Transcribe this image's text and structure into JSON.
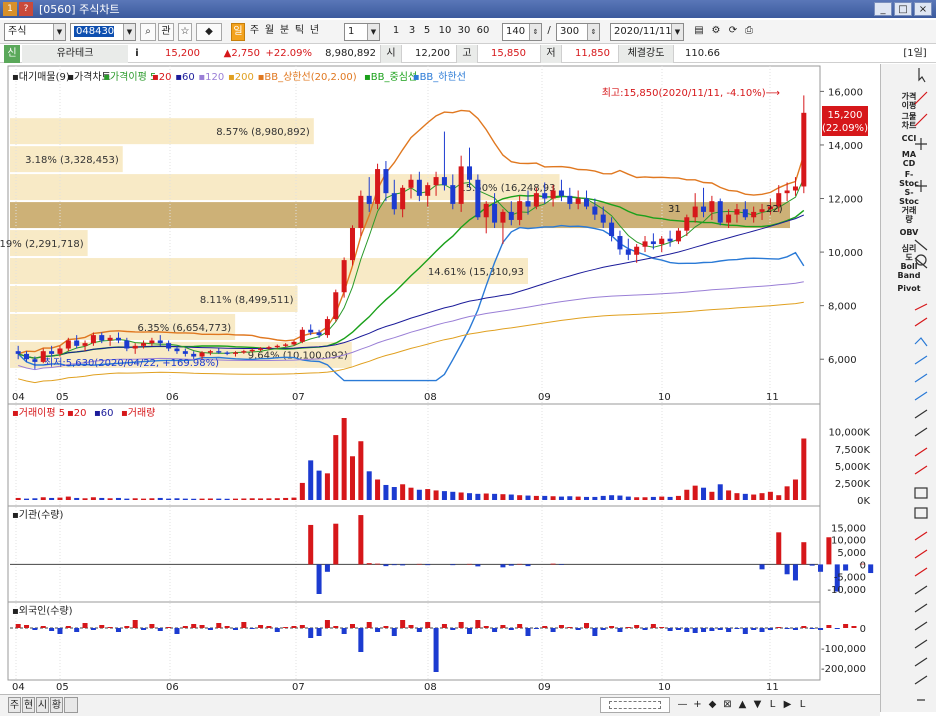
{
  "window": {
    "screen_code": "[0560]",
    "title": "주식차트",
    "buttons": [
      "_",
      "□",
      "×"
    ]
  },
  "toolbar": {
    "market": "주식",
    "code": "048430",
    "lookup_label": "관",
    "periods": [
      "일",
      "주",
      "월",
      "분",
      "틱",
      "년"
    ],
    "active_period": "일",
    "unit_value": "1",
    "minute_options": [
      "1",
      "3",
      "5",
      "10",
      "30",
      "60"
    ],
    "count_value": "140",
    "range_sep": "/",
    "total_value": "300",
    "date_value": "2020/11/11"
  },
  "info": {
    "badge": "신",
    "stock_name": "유라테크",
    "info_icon": "i",
    "price": "15,200",
    "change": "▲2,750",
    "change_pct": "+22.09%",
    "volume": "8,980,892",
    "open_label": "시",
    "open": "12,200",
    "high_label": "고",
    "high": "15,850",
    "low_label": "저",
    "low": "11,850",
    "strength_label": "체결강도",
    "strength": "110.66",
    "period_badge": "[1일]"
  },
  "legend": {
    "price": [
      {
        "text": "▪대기매물(9)",
        "color": "#222222"
      },
      {
        "text": "▪가격차트",
        "color": "#222222"
      },
      {
        "text": "▪가격이평 5",
        "color": "#2a9a2a"
      },
      {
        "text": "▪20",
        "color": "#d6171a"
      },
      {
        "text": "▪60",
        "color": "#1c1c9a"
      },
      {
        "text": "▪120",
        "color": "#9a7fd6"
      },
      {
        "text": "▪200",
        "color": "#e0a020"
      },
      {
        "text": "▪BB_상한선(20,2.00)",
        "color": "#e07820"
      },
      {
        "text": "▪BB_중심선",
        "color": "#1aa01a"
      },
      {
        "text": "▪BB_하한선",
        "color": "#2a7ad6"
      }
    ],
    "volume": [
      {
        "text": "▪거래이평 5",
        "color": "#d6171a"
      },
      {
        "text": "▪20",
        "color": "#d6171a"
      },
      {
        "text": "▪60",
        "color": "#1c1c9a"
      },
      {
        "text": "▪거래량",
        "color": "#d6171a"
      }
    ],
    "inst": "▪기관(수량)",
    "foreign": "▪외국인(수량)"
  },
  "annotations": {
    "high": "최고:15,850(2020/11/11, -4.10%)⟶",
    "low": "최저:5,630(2020/04/22, +169.98%)",
    "price_tag_1": "15,200",
    "price_tag_2": "(22.09%)"
  },
  "volume_profile": [
    {
      "label": "8.57% (8,980,892)",
      "pct": 8.57
    },
    {
      "label": "3.18% (3,328,453)",
      "pct": 3.18
    },
    {
      "label": "15.50% (16,248,93",
      "pct": 15.5
    },
    {
      "label": "",
      "pct": 22
    },
    {
      "label": "2.19% (2,291,718)",
      "pct": 2.19
    },
    {
      "label": "14.61% (15,310,93",
      "pct": 14.61
    },
    {
      "label": "8.11% (8,499,511)",
      "pct": 8.11
    },
    {
      "label": "6.35% (6,654,773)",
      "pct": 6.35
    },
    {
      "label": "9.64% (10,100,092)",
      "pct": 9.64
    }
  ],
  "overlap_label": "31",
  "overlap_label2": "22)",
  "axes": {
    "months": [
      "04",
      "05",
      "06",
      "07",
      "08",
      "09",
      "10",
      "11"
    ],
    "price_ticks": [
      "16,000",
      "14,000",
      "12,000",
      "10,000",
      "8,000",
      "6,000"
    ],
    "volume_ticks": [
      "10,000K",
      "7,500K",
      "5,000K",
      "2,500K",
      "0K"
    ],
    "inst_ticks": [
      "15,000",
      "10,000",
      "5,000",
      "0",
      "-5,000",
      "-10,000"
    ],
    "foreign_ticks": [
      "0",
      "-100,000",
      "-200,000"
    ]
  },
  "sidebar": {
    "text_items": [
      "가격\n이평",
      "그물\n차트",
      "CCI",
      "MA\nCD",
      "F-\nStoc",
      "S-\nStoc",
      "거래\n량",
      "OBV",
      "심리\n도",
      "Boll\nBand",
      "Pivot"
    ],
    "icons": [
      "cursor-icon",
      "crosshair-icon",
      "magnify-icon",
      "text-icon",
      "line-icon",
      "circle-icon",
      "fibonacci-icon",
      "trendline-icon",
      "ruler-icon",
      "print-icon"
    ]
  },
  "bottom": {
    "tabs": [
      "주",
      "현",
      "시",
      "황"
    ],
    "nav": [
      "—",
      "+",
      "◆",
      "⊠",
      "▲",
      "▼",
      "L",
      "▶",
      "L"
    ]
  },
  "chart_data": [
    {
      "type": "candlestick",
      "title": "",
      "x": [
        "04",
        "05",
        "06",
        "07",
        "08",
        "09",
        "10",
        "11"
      ],
      "ylim": [
        5000,
        16500
      ],
      "candles": [
        [
          6300,
          6500,
          6000,
          6200
        ],
        [
          6200,
          6300,
          5900,
          6000
        ],
        [
          6000,
          6100,
          5630,
          5900
        ],
        [
          5900,
          6400,
          5850,
          6300
        ],
        [
          6300,
          6500,
          6100,
          6200
        ],
        [
          6200,
          6500,
          6100,
          6400
        ],
        [
          6400,
          6800,
          6300,
          6700
        ],
        [
          6700,
          6900,
          6400,
          6500
        ],
        [
          6500,
          6700,
          6300,
          6600
        ],
        [
          6600,
          7000,
          6500,
          6900
        ],
        [
          6900,
          7000,
          6600,
          6700
        ],
        [
          6700,
          6900,
          6500,
          6800
        ],
        [
          6800,
          7000,
          6600,
          6700
        ],
        [
          6700,
          6800,
          6300,
          6400
        ],
        [
          6400,
          6600,
          6200,
          6500
        ],
        [
          6500,
          6700,
          6400,
          6600
        ],
        [
          6600,
          6800,
          6500,
          6700
        ],
        [
          6700,
          6900,
          6500,
          6600
        ],
        [
          6600,
          6700,
          6300,
          6400
        ],
        [
          6400,
          6500,
          6200,
          6300
        ],
        [
          6300,
          6400,
          6100,
          6200
        ],
        [
          6200,
          6300,
          6000,
          6100
        ],
        [
          6100,
          6300,
          6000,
          6250
        ],
        [
          6250,
          6350,
          6150,
          6300
        ],
        [
          6300,
          6400,
          6200,
          6250
        ],
        [
          6250,
          6300,
          6150,
          6200
        ],
        [
          6200,
          6300,
          6100,
          6250
        ],
        [
          6250,
          6350,
          6200,
          6300
        ],
        [
          6300,
          6400,
          6250,
          6350
        ],
        [
          6350,
          6450,
          6300,
          6400
        ],
        [
          6400,
          6500,
          6350,
          6450
        ],
        [
          6450,
          6550,
          6400,
          6500
        ],
        [
          6500,
          6600,
          6450,
          6550
        ],
        [
          6550,
          6700,
          6500,
          6650
        ],
        [
          6650,
          7200,
          6600,
          7100
        ],
        [
          7100,
          7300,
          6900,
          7000
        ],
        [
          7000,
          7100,
          6800,
          6900
        ],
        [
          6900,
          7600,
          6800,
          7500
        ],
        [
          7500,
          8600,
          7400,
          8500
        ],
        [
          8500,
          9800,
          8300,
          9700
        ],
        [
          9700,
          11000,
          9500,
          10900
        ],
        [
          10900,
          12300,
          10600,
          12100
        ],
        [
          12100,
          12800,
          11500,
          11800
        ],
        [
          11800,
          13300,
          11600,
          13100
        ],
        [
          13100,
          13400,
          11900,
          12200
        ],
        [
          12200,
          12700,
          11400,
          11600
        ],
        [
          11600,
          12500,
          11300,
          12400
        ],
        [
          12400,
          12900,
          12000,
          12700
        ],
        [
          12700,
          13000,
          11900,
          12100
        ],
        [
          12100,
          12600,
          11700,
          12500
        ],
        [
          12500,
          13000,
          12100,
          12800
        ],
        [
          12800,
          14500,
          12300,
          12500
        ],
        [
          12500,
          12900,
          11600,
          11800
        ],
        [
          11800,
          13600,
          11500,
          13200
        ],
        [
          13200,
          13900,
          12400,
          12700
        ],
        [
          12700,
          12900,
          11200,
          11300
        ],
        [
          11300,
          11900,
          10700,
          11800
        ],
        [
          11800,
          12200,
          10900,
          11100
        ],
        [
          11100,
          11600,
          10300,
          11500
        ],
        [
          11500,
          11900,
          11000,
          11200
        ],
        [
          11200,
          12100,
          11000,
          11900
        ],
        [
          11900,
          12300,
          11400,
          11700
        ],
        [
          11700,
          12400,
          11600,
          12200
        ],
        [
          12200,
          12600,
          11800,
          12000
        ],
        [
          12000,
          12500,
          11700,
          12300
        ],
        [
          12300,
          12700,
          11900,
          12100
        ],
        [
          12100,
          12400,
          11600,
          11800
        ],
        [
          11800,
          12300,
          11600,
          12000
        ],
        [
          12000,
          12300,
          11600,
          11700
        ],
        [
          11700,
          12000,
          11200,
          11400
        ],
        [
          11400,
          11700,
          10900,
          11100
        ],
        [
          11100,
          11300,
          10400,
          10600
        ],
        [
          10600,
          10800,
          9900,
          10100
        ],
        [
          10100,
          10500,
          9700,
          9900
        ],
        [
          9900,
          10300,
          9600,
          10200
        ],
        [
          10200,
          10600,
          10000,
          10400
        ],
        [
          10400,
          10700,
          10100,
          10300
        ],
        [
          10300,
          10600,
          10000,
          10500
        ],
        [
          10500,
          10800,
          10200,
          10400
        ],
        [
          10400,
          10900,
          10300,
          10800
        ],
        [
          10800,
          11400,
          10600,
          11300
        ],
        [
          11300,
          12200,
          11100,
          11700
        ],
        [
          11700,
          12400,
          11300,
          11500
        ],
        [
          11500,
          12100,
          11200,
          11900
        ],
        [
          11900,
          12000,
          11000,
          11100
        ],
        [
          11100,
          11600,
          10900,
          11400
        ],
        [
          11400,
          11800,
          11100,
          11600
        ],
        [
          11600,
          11900,
          11200,
          11300
        ],
        [
          11300,
          11700,
          11100,
          11500
        ],
        [
          11500,
          11800,
          11200,
          11600
        ],
        [
          11600,
          12000,
          11400,
          11700
        ],
        [
          11700,
          12500,
          11500,
          12200
        ],
        [
          12200,
          12600,
          11900,
          12300
        ],
        [
          12300,
          12800,
          12100,
          12450
        ],
        [
          12450,
          15850,
          12200,
          15200
        ]
      ]
    },
    {
      "type": "bar",
      "title": "",
      "ylabel": "거래량",
      "ylim": [
        0,
        12000
      ],
      "values": [
        300,
        200,
        250,
        400,
        300,
        350,
        500,
        300,
        250,
        400,
        300,
        250,
        300,
        200,
        250,
        200,
        250,
        300,
        200,
        250,
        200,
        180,
        200,
        220,
        200,
        180,
        200,
        220,
        250,
        230,
        240,
        260,
        300,
        350,
        2500,
        5800,
        4300,
        3900,
        9500,
        12000,
        6400,
        8600,
        4200,
        3000,
        2200,
        1900,
        2300,
        1800,
        1500,
        1600,
        1400,
        1300,
        1200,
        1100,
        1000,
        900,
        950,
        900,
        850,
        800,
        700,
        650,
        600,
        600,
        550,
        500,
        550,
        500,
        450,
        450,
        600,
        700,
        650,
        500,
        400,
        400,
        450,
        500,
        450,
        600,
        1500,
        2100,
        1800,
        1200,
        2300,
        1400,
        1000,
        900,
        800,
        1000,
        1200,
        700,
        2000,
        3000,
        9000
      ]
    },
    {
      "type": "bar",
      "title": "",
      "ylabel": "기관(수량)",
      "ylim": [
        -12000,
        18000
      ],
      "values": [
        0,
        0,
        0,
        0,
        0,
        0,
        0,
        0,
        0,
        0,
        0,
        0,
        0,
        0,
        0,
        0,
        0,
        0,
        0,
        0,
        0,
        0,
        0,
        0,
        0,
        0,
        0,
        0,
        0,
        0,
        0,
        0,
        0,
        0,
        0,
        16000,
        -12000,
        -3000,
        16500,
        0,
        0,
        20000,
        500,
        300,
        -700,
        -300,
        -400,
        0,
        200,
        -300,
        0,
        0,
        -300,
        0,
        200,
        -800,
        0,
        0,
        -1200,
        -500,
        200,
        -700,
        0,
        0,
        300,
        -200,
        0,
        0,
        0,
        0,
        0,
        0,
        0,
        0,
        0,
        0,
        0,
        0,
        0,
        0,
        0,
        0,
        0,
        0,
        0,
        0,
        0,
        0,
        0,
        -2000,
        0,
        13000,
        -4000,
        -6500,
        9000,
        -500,
        -3000,
        11000,
        -11000,
        -2500,
        0,
        300,
        -3500,
        0,
        900
      ]
    },
    {
      "type": "bar",
      "title": "",
      "ylabel": "외국인(수량)",
      "ylim": [
        -250000,
        50000
      ],
      "values": [
        20000,
        15000,
        -10000,
        10000,
        -15000,
        -30000,
        10000,
        -20000,
        25000,
        -10000,
        15000,
        5000,
        -20000,
        10000,
        40000,
        -10000,
        20000,
        -15000,
        5000,
        -30000,
        10000,
        20000,
        15000,
        -10000,
        25000,
        10000,
        -10000,
        30000,
        -5000,
        15000,
        10000,
        -20000,
        5000,
        10000,
        15000,
        -50000,
        -40000,
        40000,
        10000,
        -30000,
        20000,
        -120000,
        30000,
        -20000,
        10000,
        -40000,
        40000,
        15000,
        -20000,
        30000,
        -220000,
        20000,
        -10000,
        30000,
        -30000,
        40000,
        10000,
        -20000,
        15000,
        -10000,
        20000,
        -40000,
        -5000,
        10000,
        -20000,
        15000,
        5000,
        -10000,
        25000,
        -40000,
        -10000,
        10000,
        -20000,
        5000,
        15000,
        -10000,
        20000,
        5000,
        -15000,
        -10000,
        -20000,
        -25000,
        -20000,
        -15000,
        -10000,
        -20000,
        -5000,
        -30000,
        -10000,
        -20000,
        -10000,
        5000,
        -5000,
        -10000,
        10000,
        -5000,
        -10000,
        15000,
        -5000,
        20000,
        10000
      ]
    }
  ]
}
